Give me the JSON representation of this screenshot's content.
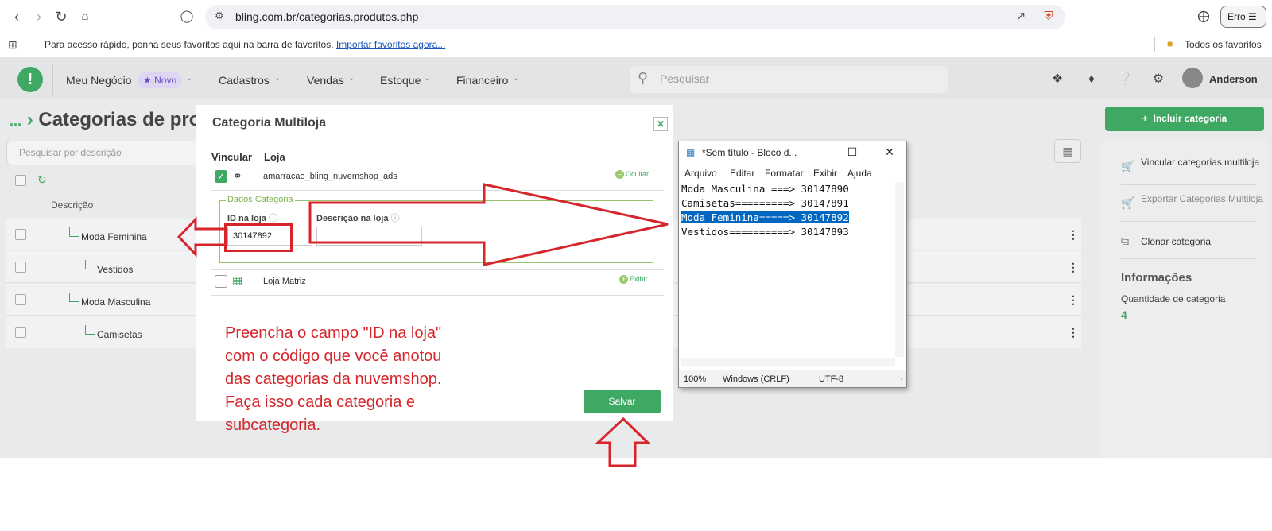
{
  "browser": {
    "url": "bling.com.br/categorias.produtos.php",
    "bookmarks_hint": "Para acesso rápido, ponha seus favoritos aqui na barra de favoritos.",
    "bookmarks_import": "Importar favoritos agora...",
    "all_bookmarks": "Todos os favoritos",
    "error_button": "Erro"
  },
  "header": {
    "nav": [
      "Meu Negócio",
      "Cadastros",
      "Vendas",
      "Estoque",
      "Financeiro"
    ],
    "badge_new": "Novo",
    "search_placeholder": "Pesquisar",
    "user_name": "Anderson"
  },
  "page": {
    "breadcrumb_dots": "...",
    "title": "Categorias de pro",
    "search_placeholder": "Pesquisar por descrição",
    "column_description": "Descrição",
    "rows": [
      "Moda Feminina",
      "Vestidos",
      "Moda Masculina",
      "Camisetas"
    ]
  },
  "sidebar": {
    "add_button": "Incluir categoria",
    "actions": [
      "Vincular categorias multiloja",
      "Exportar Categorias Multiloja",
      "Clonar categoria"
    ],
    "info_title": "Informações",
    "info_label": "Quantidade de categoria",
    "info_value": "4"
  },
  "dialog": {
    "title": "Categoria Multiloja",
    "col_link": "Vincular",
    "col_store": "Loja",
    "store1_name": "amarracao_bling_nuvemshop_ads",
    "store1_toggle": "Ocultar",
    "fieldset_legend": "Dados Categoria",
    "id_label": "ID na loja",
    "id_value": "30147892",
    "desc_label": "Descrição na loja",
    "desc_value": "",
    "store2_name": "Loja Matriz",
    "store2_toggle": "Exibir",
    "save_button": "Salvar"
  },
  "annotation": {
    "note": "Preencha o campo \"ID na loja\" com o código que você anotou das categorias da nuvemshop. Faça isso cada categoria e subcategoria.",
    "arrow_color": "#d6262b"
  },
  "notepad": {
    "title": "*Sem título - Bloco d...",
    "menu": [
      "Arquivo",
      "Editar",
      "Formatar",
      "Exibir",
      "Ajuda"
    ],
    "lines": [
      "Moda Masculina ===> 30147890",
      "Camisetas=========> 30147891",
      "Moda Feminina=====> 30147892",
      "Vestidos==========> 30147893"
    ],
    "status_zoom": "100%",
    "status_eol": "Windows (CRLF)",
    "status_encoding": "UTF-8"
  },
  "colors": {
    "brand_green": "#3fa964",
    "selection_blue": "#0067c0"
  }
}
